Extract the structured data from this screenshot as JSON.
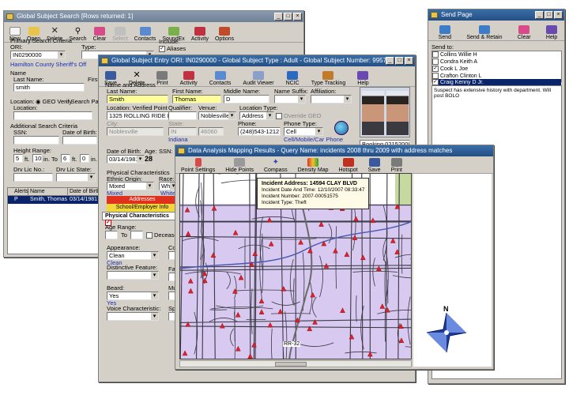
{
  "search_window": {
    "title": "Global Subject Search [Rows returned: 1]",
    "toolbar": [
      "New",
      "Open",
      "Delete",
      "Search",
      "Clear",
      "Select",
      "Contacts",
      "SoundEx",
      "Activity",
      "Options"
    ],
    "primary_label": "Primary Search Criteria",
    "ori_label": "ORI:",
    "ori_value": "IN0290000",
    "type_label": "Type:",
    "agency": "Hamilton County Sheriff's Off",
    "include_label": "Include:",
    "aliases_label": "Aliases",
    "name_label": "Name",
    "last_name_label": "Last Name:",
    "last_name_value": "smith",
    "first_label": "First N",
    "location_label": "Location:",
    "geo_verify": "GEO Verify",
    "search_partial": "Search Partial Ad",
    "location_sub_label": "Location:",
    "additional_label": "Additional Search Criteria",
    "ssn_label": "SSN:",
    "dob_label": "Date of Birth:",
    "height_label": "Height Range:",
    "height_from_ft": "5",
    "height_from_in": "10",
    "height_to_ft": "6",
    "height_to_in": "0",
    "ft": "ft.",
    "in": "in.",
    "to": "To",
    "drv_lic_no": "Drv Lic No.:",
    "drv_lic_state": "Drv Lic State:",
    "results_headers": [
      "Alerts",
      "Name",
      "Date of Birth"
    ],
    "results_row": {
      "alerts": "P",
      "name": "Smith, Thomas D",
      "dob": "03/14/1981"
    }
  },
  "send_page": {
    "title": "Send Page",
    "toolbar": [
      "Send",
      "Send & Retain",
      "Clear",
      "Help"
    ],
    "send_to_label": "Send to:",
    "recipients": [
      {
        "name": "Collins Willie H",
        "checked": false
      },
      {
        "name": "Condra Keith A",
        "checked": false
      },
      {
        "name": "Cook L Joe",
        "checked": true
      },
      {
        "name": "Crafton Clinton L",
        "checked": false
      },
      {
        "name": "Craig Kenny D Jr.",
        "checked": true
      }
    ],
    "message": "Suspect has extensive history with department. Will post BOLO"
  },
  "entry_window": {
    "title": "Global Subject Entry  ORI: IN0290000 - Global Subject Type : Adult - Global Subject Number: 99571",
    "toolbar": [
      "Save",
      "Delete",
      "Print",
      "Activity",
      "Contacts",
      "Audit Viewer",
      "NCIC",
      "Type Tracking",
      "Help"
    ],
    "name_address_label": "Name and Address",
    "last_name_label": "Last Name:",
    "last_name_value": "Smith",
    "first_name_label": "First Name:",
    "first_name_value": "Thomas",
    "middle_name_label": "Middle Name:",
    "middle_name_value": "D",
    "suffix_label": "Name Suffix:",
    "affiliation_label": "Affiliation:",
    "location_label": "Location: Verified Point",
    "location_value": "1325 ROLLING RIDE DR",
    "qualifier_label": "Qualifier:",
    "venue_label": "Venue:",
    "venue_value": "Noblesville",
    "location_type_label": "Location Type:",
    "location_type_value": "Address",
    "override_geo": "Override GEO",
    "city_label": "City:",
    "city_value": "Noblesville",
    "state_label": "State:",
    "state_value": "IN",
    "zip_value": "46060",
    "state_full": "Indiana",
    "phone_label": "Phone:",
    "phone_value": "(248)543-1212",
    "phone_type_label": "Phone Type:",
    "phone_type_value": "Cell",
    "phone_type_note": "Cell/Mobile/Car Phone",
    "booking": "Booking 02152008",
    "dob_label": "Date of Birth:",
    "dob_value": "03/14/1981",
    "age_label": "Age:",
    "age_value": "28",
    "ssn_label": "SSN:",
    "phys_label": "Physical Characteristics",
    "ethnic_label": "Ethnic Origin:",
    "ethnic_value": "Mixed",
    "ethnic_note": "Mixed",
    "race_label": "Race:",
    "race_value": "White",
    "race_note": "White",
    "tab_addresses": "Addresses",
    "tab_school": "School/Employer Info",
    "tab_phys": "Physical Characteristics",
    "age_range_label": "Age Range:",
    "age_to": "To",
    "deceased_label": "Deceased",
    "appearance_label": "Appearance:",
    "appearance_value": "Clean",
    "appearance_note": "Clean",
    "distinctive_label": "Distinctive Feature:",
    "beard_label": "Beard:",
    "beard_value": "Yes",
    "beard_note": "Yes",
    "voice_label": "Voice Characteristic:",
    "col2_labels": [
      "Com",
      "Fac",
      "Mus",
      "Spe"
    ]
  },
  "map_window": {
    "title": "Data Analysis Mapping Results - Query Name: incidents 2008 thru 2009 with address matches",
    "toolbar": [
      "Point Settings",
      "Hide Points",
      "Compass",
      "Density Map",
      "Hotspot",
      "Save",
      "Print"
    ],
    "tooltip": {
      "address": "Incident Address: 14594 CLAY BLVD",
      "date": "Incident Date And Time: 12/10/2007 08:33:47",
      "number": "Incident Number: 2007-00051575",
      "type": "Incident Type: Theft"
    },
    "road_label": "RR-32",
    "compass_n": "N"
  },
  "colors": {
    "title_active": "#244f86",
    "window_bg": "#d4d0c8",
    "map_fill": "#d7c9ef",
    "incident_marker": "#e0202a",
    "highlight_yellow": "#ffff99",
    "tab_red": "#e0301e",
    "tab_yellow": "#f2d73a"
  }
}
